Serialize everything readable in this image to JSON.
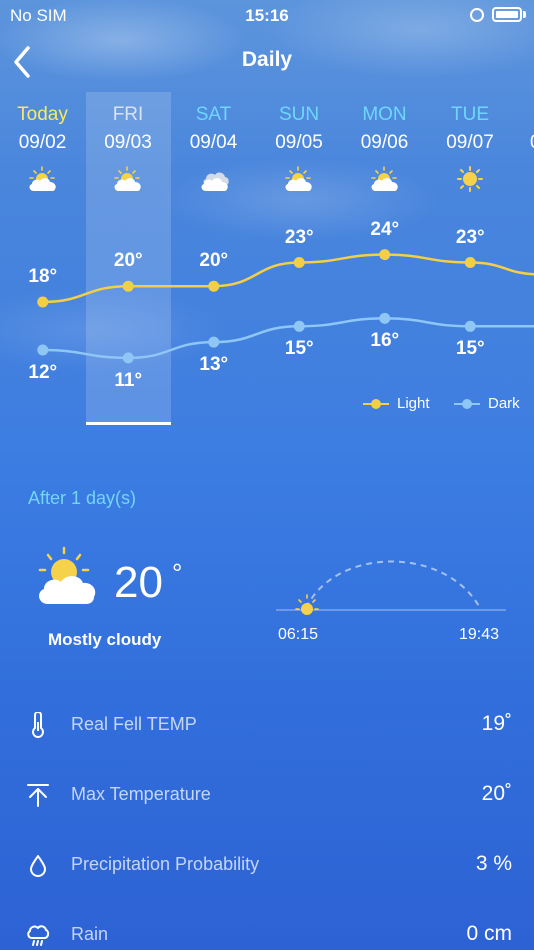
{
  "status_bar": {
    "carrier": "No SIM",
    "time": "15:16"
  },
  "header": {
    "title": "Daily"
  },
  "days": [
    {
      "name": "Today",
      "date": "09/02",
      "icon": "partly-cloudy-icon",
      "high": "18",
      "low": "12",
      "selected": false
    },
    {
      "name": "FRI",
      "date": "09/03",
      "icon": "partly-cloudy-icon",
      "high": "20",
      "low": "11",
      "selected": true
    },
    {
      "name": "SAT",
      "date": "09/04",
      "icon": "cloudy-icon",
      "high": "20",
      "low": "13",
      "selected": false
    },
    {
      "name": "SUN",
      "date": "09/05",
      "icon": "partly-cloudy-icon",
      "high": "23",
      "low": "15",
      "selected": false
    },
    {
      "name": "MON",
      "date": "09/06",
      "icon": "partly-cloudy-icon",
      "high": "24",
      "low": "16",
      "selected": false
    },
    {
      "name": "TUE",
      "date": "09/07",
      "icon": "sunny-icon",
      "high": "23",
      "low": "15",
      "selected": false
    },
    {
      "name": "",
      "date": "0",
      "icon": "",
      "high": "",
      "low": "",
      "selected": false
    }
  ],
  "degree_symbol": "°",
  "legend": {
    "light": "Light",
    "dark": "Dark"
  },
  "colors": {
    "today": "#f7e96a",
    "weekday": "#6fd6ff",
    "selected": "#d7e3f4",
    "light_line": "#f2cf45",
    "dark_line": "#8ec7f5",
    "accent": "#73d6f5"
  },
  "selected_day": {
    "after_label": "After 1  day(s)",
    "temperature": "20",
    "degree": "°",
    "condition": "Mostly cloudy",
    "icon": "partly-cloudy-icon",
    "sunrise": "06:15",
    "sunset": "19:43"
  },
  "details": [
    {
      "icon": "thermometer-icon",
      "label": "Real Fell TEMP",
      "value": "19˚"
    },
    {
      "icon": "arrow-up-icon",
      "label": "Max Temperature",
      "value": "20˚"
    },
    {
      "icon": "droplet-icon",
      "label": "Precipitation Probability",
      "value": "3 %"
    },
    {
      "icon": "rain-cloud-icon",
      "label": "Rain",
      "value": "0 cm"
    }
  ]
}
